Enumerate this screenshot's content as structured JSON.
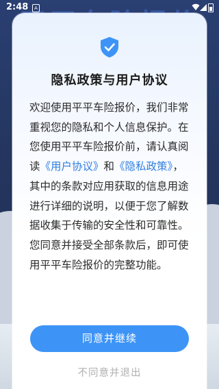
{
  "status_bar": {
    "time": "2:48",
    "notification_icon": "a-box-icon",
    "icons": [
      "wifi-icon",
      "signal-icon",
      "battery-icon"
    ]
  },
  "background": {
    "title": "平平车险报价"
  },
  "dialog": {
    "icon": "shield-check-icon",
    "title": "隐私政策与用户协议",
    "body": {
      "part1": "欢迎使用平平车险报价，我们非常重视您的隐私和个人信息保护。在您使用平平车险报价前，请认真阅读",
      "user_agreement_link": "《用户协议》",
      "and": "和",
      "privacy_policy_link": "《隐私政策》",
      "part2": "，其中的条款对应用获取的信息用途进行详细的说明，以便于您了解数据收集于传输的安全性和可靠性。您同意并接受全部条款后，即可使用平平车险报价的完整功能。"
    },
    "agree_button": "同意并继续",
    "disagree_button": "不同意并退出"
  },
  "colors": {
    "accent": "#3d94f6",
    "link": "#2f7fe0",
    "shield": "#3d94f6"
  }
}
